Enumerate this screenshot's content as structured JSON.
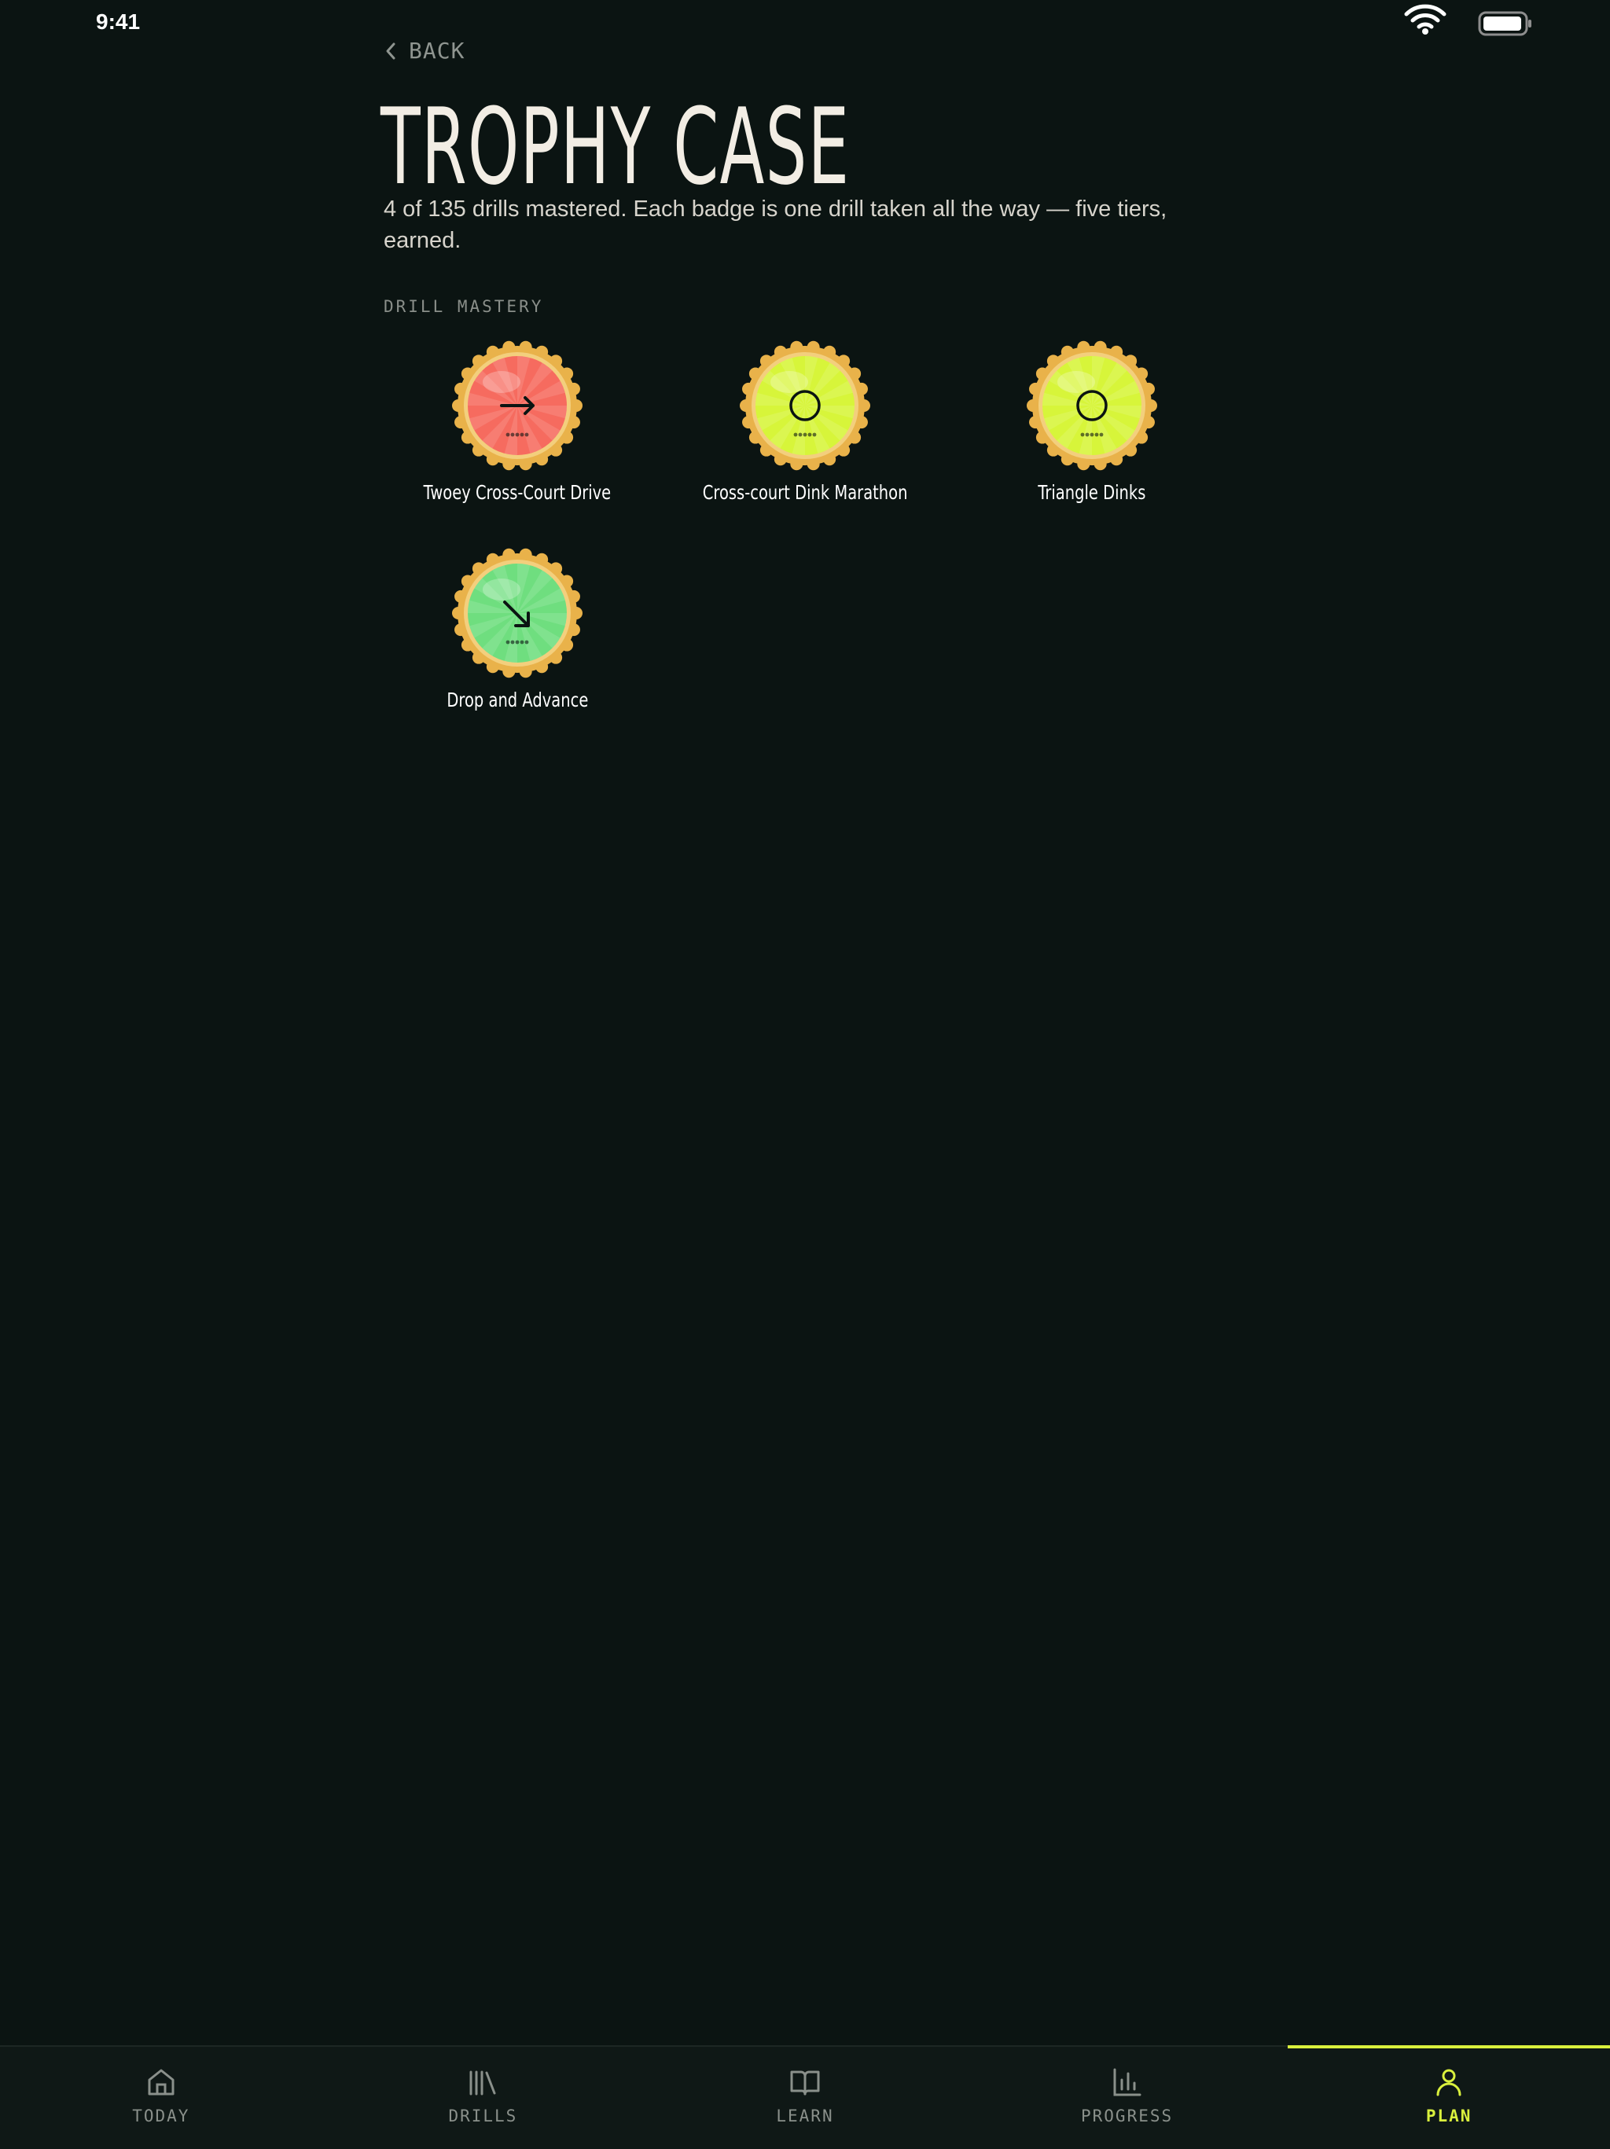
{
  "status_bar": {
    "time": "9:41",
    "icons": [
      "wifi-icon",
      "battery-icon"
    ]
  },
  "header": {
    "back_label": "BACK",
    "title": "TROPHY CASE",
    "subtitle": "4 of 135 drills mastered. Each badge is one drill taken all the way — five tiers, earned."
  },
  "section": {
    "label": "DRILL MASTERY"
  },
  "badges": [
    {
      "label": "Twoey Cross-Court Drive",
      "icon": "arrow-right-icon",
      "color": "#f66b5f",
      "tiers": 5
    },
    {
      "label": "Cross-court Dink Marathon",
      "icon": "circle-icon",
      "color": "#d7f53a",
      "tiers": 5
    },
    {
      "label": "Triangle Dinks",
      "icon": "circle-icon",
      "color": "#d7f53a",
      "tiers": 5
    },
    {
      "label": "Drop and Advance",
      "icon": "arrow-down-right-icon",
      "color": "#6fde7f",
      "tiers": 5
    }
  ],
  "colors": {
    "background": "#0b1412",
    "accent": "#d9f03d",
    "ring": "#e9b24a"
  },
  "tabs": [
    {
      "label": "TODAY",
      "icon": "home-icon",
      "active": false
    },
    {
      "label": "DRILLS",
      "icon": "library-icon",
      "active": false
    },
    {
      "label": "LEARN",
      "icon": "book-icon",
      "active": false
    },
    {
      "label": "PROGRESS",
      "icon": "bar-chart-icon",
      "active": false
    },
    {
      "label": "PLAN",
      "icon": "user-icon",
      "active": true
    }
  ]
}
